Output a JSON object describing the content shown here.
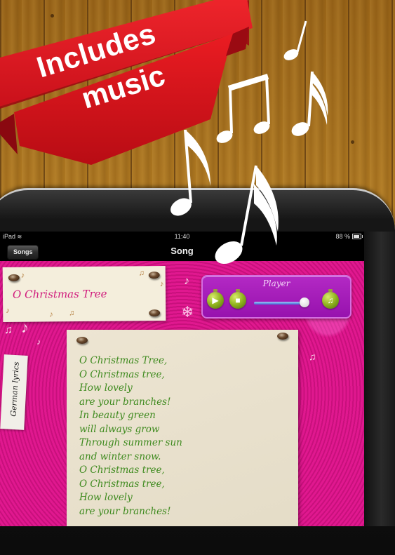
{
  "promo": {
    "banner_line1": "Includes",
    "banner_line2": "music",
    "banner_color": "#e0171f"
  },
  "status_bar": {
    "device": "iPad",
    "wifi_icon": "wifi-icon",
    "time": "11:40",
    "battery_percent": "88 %",
    "battery_icon": "battery-icon"
  },
  "nav_bar": {
    "back_label": "Songs",
    "title": "Song"
  },
  "song": {
    "title": "O Christmas Tree",
    "title_color": "#d01a7c",
    "lyrics_color": "#3e8a1e",
    "lyrics": [
      "O Christmas Tree,",
      "O Christmas tree,",
      "How lovely",
      "are your branches!",
      "In beauty green",
      "will always grow",
      "Through summer sun",
      "and winter snow.",
      "O Christmas tree,",
      "O Christmas tree,",
      "How lovely",
      "are your branches!"
    ]
  },
  "player": {
    "title": "Player",
    "play_icon": "▶",
    "stop_icon": "■",
    "music_icon": "♫",
    "volume_fraction": 0.92
  },
  "tag": {
    "label": "German lyrics"
  },
  "decor": {
    "eighth_note": "♪",
    "beamed_notes": "♫",
    "snowflake": "❄"
  }
}
